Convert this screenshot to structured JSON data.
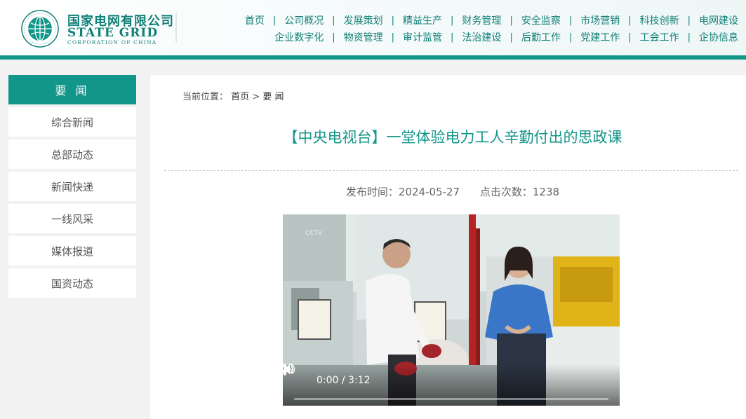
{
  "header": {
    "logo": {
      "cn_name": "国家电网有限公司",
      "en_name": "STATE GRID",
      "en_sub": "CORPORATION OF CHINA",
      "emblem_text": "STATE GRID CORPORATION OF CHINA"
    },
    "nav_row1": [
      "首页",
      "公司概况",
      "发展策划",
      "精益生产",
      "财务管理",
      "安全监察",
      "市场营销",
      "科技创新",
      "电网建设"
    ],
    "nav_row2": [
      "企业数字化",
      "物资管理",
      "审计监管",
      "法治建设",
      "后勤工作",
      "党建工作",
      "工会工作",
      "企协信息"
    ],
    "separator": "|",
    "accent_color": "#13968a"
  },
  "sidebar": {
    "title": "要 闻",
    "items": [
      "综合新闻",
      "总部动态",
      "新闻快递",
      "一线风采",
      "媒体报道",
      "国资动态"
    ]
  },
  "breadcrumb": {
    "prefix": "当前位置：",
    "home": "首页",
    "sep": ">",
    "current": "要 闻"
  },
  "article": {
    "title": "【中央电视台】一堂体验电力工人辛勤付出的思政课",
    "publish_label": "发布时间：2024-05-27",
    "clicks_label": "点击次数：1238"
  },
  "video": {
    "time_text": "0:00 / 3:12",
    "progress": 0,
    "watermark": "CCTV"
  }
}
